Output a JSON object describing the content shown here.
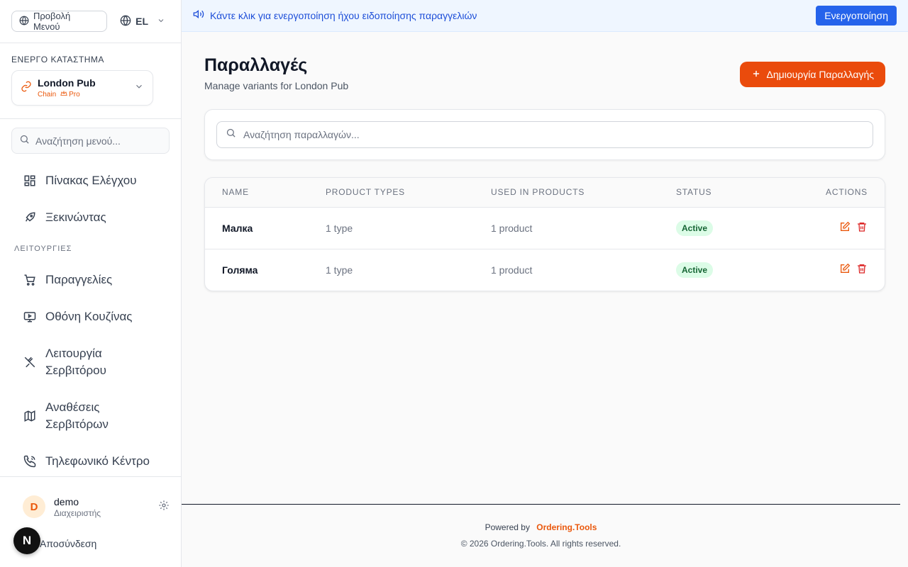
{
  "sidebar": {
    "menu_view_label": "Προβολή Μενού",
    "language": "EL",
    "store_heading": "ΕΝΕΡΓΟ ΚΑΤΑΣΤΗΜΑ",
    "store": {
      "name": "London Pub",
      "type": "Chain",
      "plan": "Pro"
    },
    "search_placeholder": "Αναζήτηση μενού...",
    "nav_top": [
      {
        "label": "Πίνακας Ελέγχου",
        "icon": "dashboard-icon"
      },
      {
        "label": "Ξεκινώντας",
        "icon": "rocket-icon"
      }
    ],
    "section_label": "ΛΕΙΤΟΥΡΓΙΕΣ",
    "nav_ops": [
      {
        "label": "Παραγγελίες",
        "icon": "cart-icon"
      },
      {
        "label": "Οθόνη Κουζίνας",
        "icon": "monitor-icon"
      },
      {
        "label1": "Λειτουργία",
        "label2": "Σερβιτόρου",
        "icon": "utensils-icon"
      },
      {
        "label1": "Αναθέσεις",
        "label2": "Σερβιτόρων",
        "icon": "map-icon"
      },
      {
        "label": "Τηλεφωνικό Κέντρο",
        "icon": "phone-icon"
      }
    ],
    "user": {
      "initial": "D",
      "name": "demo",
      "role": "Διαχειριστής"
    },
    "logout_label": "Αποσύνδεση",
    "next_badge": "N"
  },
  "banner": {
    "text": "Κάντε κλικ για ενεργοποίηση ήχου ειδοποίησης παραγγελιών",
    "button": "Ενεργοποίηση"
  },
  "page": {
    "title": "Παραλλαγές",
    "subtitle": "Manage variants for London Pub",
    "create_button": "Δημιουργία Παραλλαγής",
    "search_placeholder": "Αναζήτηση παραλλαγών..."
  },
  "table": {
    "headers": [
      "NAME",
      "PRODUCT TYPES",
      "USED IN PRODUCTS",
      "STATUS",
      "ACTIONS"
    ],
    "rows": [
      {
        "name": "Малка",
        "types": "1 type",
        "used": "1 product",
        "status": "Active"
      },
      {
        "name": "Голяма",
        "types": "1 type",
        "used": "1 product",
        "status": "Active"
      }
    ]
  },
  "footer": {
    "powered_by": "Powered by",
    "brand": "Ordering.Tools",
    "copyright": "© 2026 Ordering.Tools. All rights reserved."
  },
  "colors": {
    "accent": "#ea4b0c",
    "banner_button": "#2563eb",
    "status_bg": "#dcfce7",
    "status_text": "#166534"
  }
}
